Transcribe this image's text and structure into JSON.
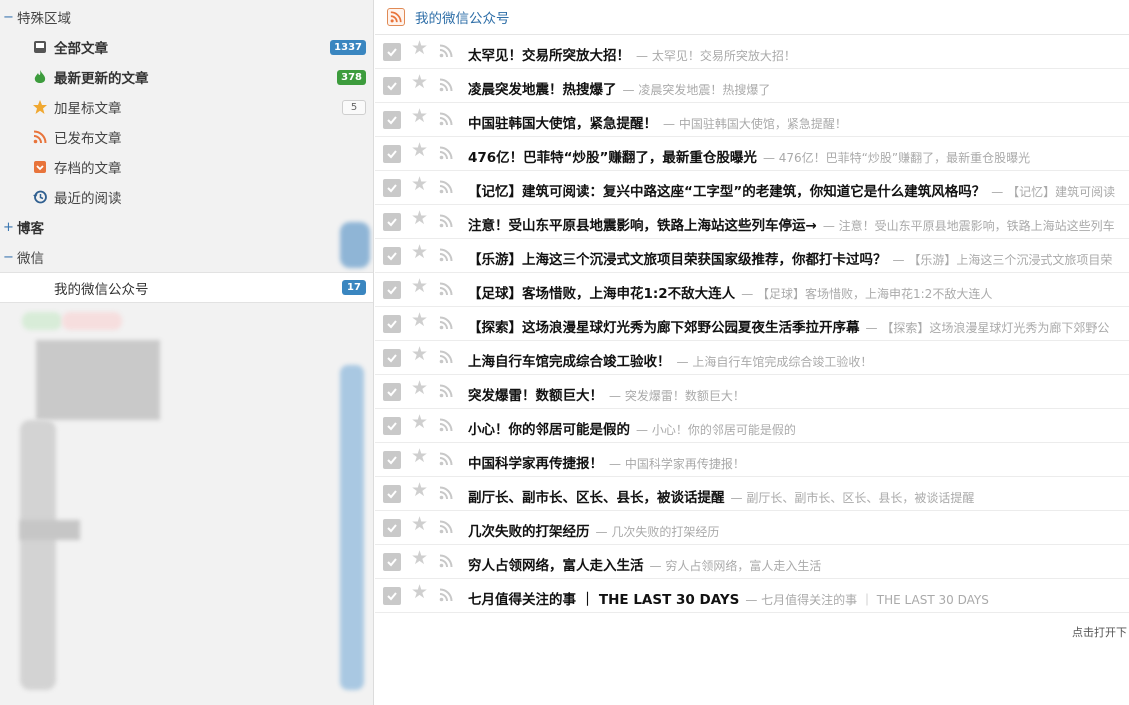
{
  "sidebar": {
    "special_section": "特殊区域",
    "special_items": [
      {
        "label": "全部文章",
        "badge": "1337",
        "icon": "inbox-icon"
      },
      {
        "label": "最新更新的文章",
        "badge": "378",
        "icon": "flame-icon"
      },
      {
        "label": "加星标文章",
        "badge": "5",
        "icon": "star-icon"
      },
      {
        "label": "已发布文章",
        "icon": "rss-icon"
      },
      {
        "label": "存档的文章",
        "icon": "archive-icon"
      },
      {
        "label": "最近的阅读",
        "icon": "history-icon"
      }
    ],
    "blog_category": "博客",
    "wechat_category": "微信",
    "wechat_feed": {
      "label": "我的微信公众号",
      "badge": "17"
    },
    "toggle_expanded": "−",
    "toggle_collapsed": "+"
  },
  "feed": {
    "title": "我的微信公众号"
  },
  "articles": [
    {
      "title": "太罕见！交易所突放大招！",
      "snippet": "— 太罕见！交易所突放大招！"
    },
    {
      "title": "凌晨突发地震！热搜爆了",
      "snippet": "— 凌晨突发地震！热搜爆了"
    },
    {
      "title": "中国驻韩国大使馆，紧急提醒！",
      "snippet": "— 中国驻韩国大使馆，紧急提醒！"
    },
    {
      "title": "476亿！巴菲特“炒股”赚翻了，最新重仓股曝光",
      "snippet": "— 476亿！巴菲特“炒股”赚翻了，最新重仓股曝光"
    },
    {
      "title": "【记忆】建筑可阅读：复兴中路这座“工字型”的老建筑，你知道它是什么建筑风格吗？",
      "snippet": "— 【记忆】建筑可阅读"
    },
    {
      "title": "注意！受山东平原县地震影响，铁路上海站这些列车停运→",
      "snippet": "— 注意！受山东平原县地震影响，铁路上海站这些列车"
    },
    {
      "title": "【乐游】上海这三个沉浸式文旅项目荣获国家级推荐，你都打卡过吗？",
      "snippet": "— 【乐游】上海这三个沉浸式文旅项目荣"
    },
    {
      "title": "【足球】客场惜败，上海申花1:2不敌大连人",
      "snippet": "— 【足球】客场惜败，上海申花1:2不敌大连人"
    },
    {
      "title": "【探索】这场浪漫星球灯光秀为廊下郊野公园夏夜生活季拉开序幕",
      "snippet": "— 【探索】这场浪漫星球灯光秀为廊下郊野公"
    },
    {
      "title": "上海自行车馆完成综合竣工验收！",
      "snippet": "— 上海自行车馆完成综合竣工验收！"
    },
    {
      "title": "突发爆雷！数额巨大！",
      "snippet": "— 突发爆雷！数额巨大！"
    },
    {
      "title": "小心！你的邻居可能是假的",
      "snippet": "— 小心！你的邻居可能是假的"
    },
    {
      "title": "中国科学家再传捷报！",
      "snippet": "— 中国科学家再传捷报！"
    },
    {
      "title": "副厅长、副市长、区长、县长，被谈话提醒",
      "snippet": "— 副厅长、副市长、区长、县长，被谈话提醒"
    },
    {
      "title": "几次失败的打架经历",
      "snippet": "— 几次失败的打架经历"
    },
    {
      "title": "穷人占领网络，富人走入生活",
      "snippet": "— 穷人占领网络，富人走入生活"
    },
    {
      "title": "七月值得关注的事 ｜ THE LAST 30 DAYS",
      "snippet": "— 七月值得关注的事 ｜ THE LAST 30 DAYS"
    }
  ],
  "footer_link": "点击打开下",
  "colors": {
    "accent": "#2f6fa8",
    "badge_blue": "#3a86c0",
    "badge_green": "#3d9c3d",
    "rss": "#e8743b"
  }
}
